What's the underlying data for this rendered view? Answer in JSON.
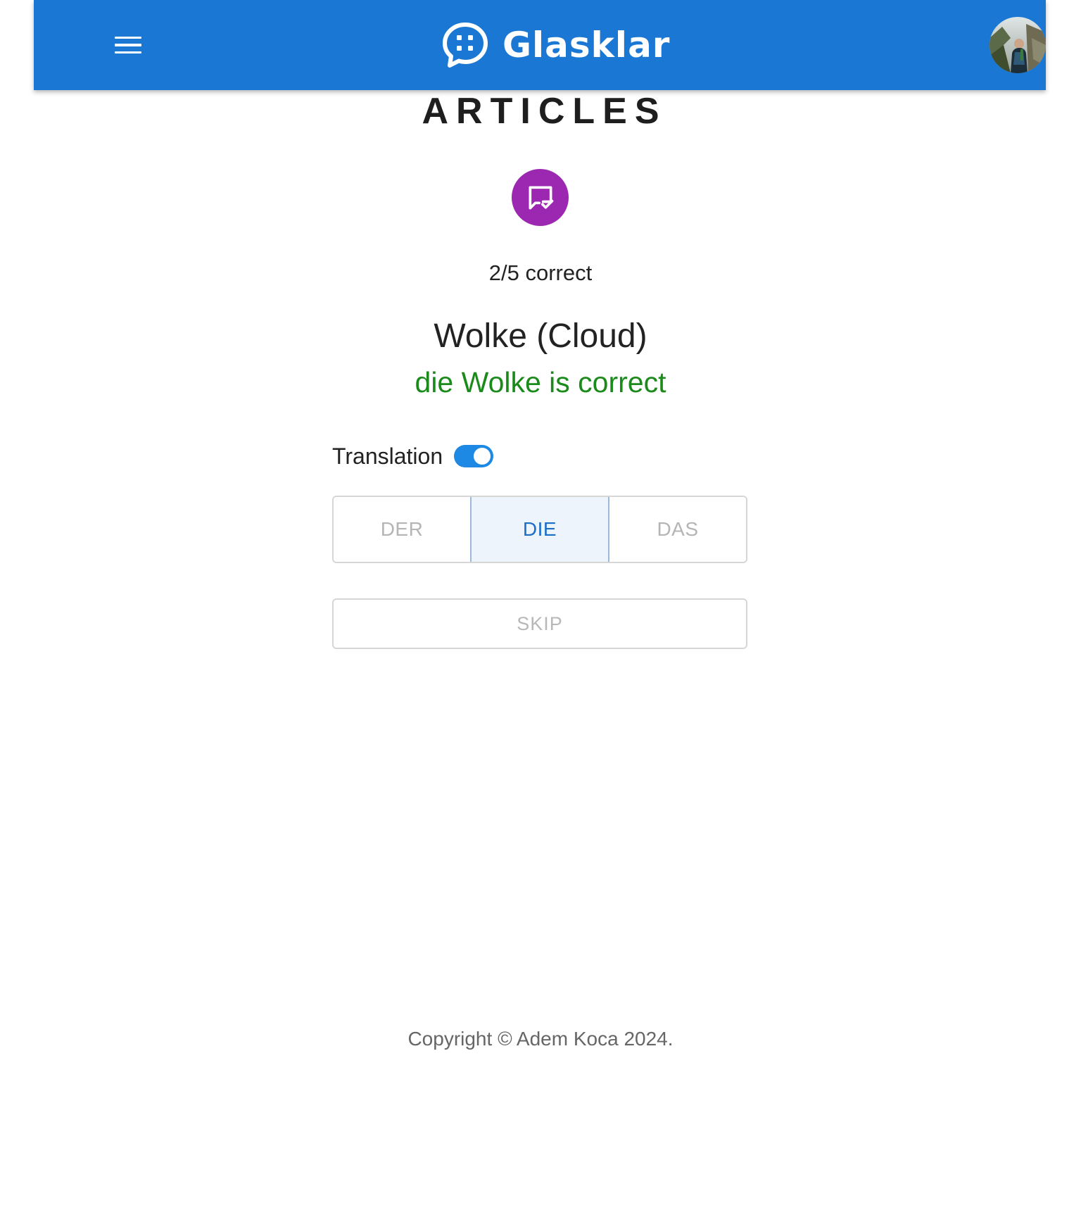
{
  "app": {
    "name": "Glasklar",
    "brand_color": "#1a78d4"
  },
  "header": {
    "menu_icon": "hamburger-menu-icon",
    "logo_icon": "chat-bubble-dots-icon",
    "avatar_icon": "user-avatar-photo"
  },
  "main": {
    "title": "ARTICLES",
    "badge_icon": "message-check-icon",
    "badge_color": "#9c27b0",
    "score": "2/5 correct",
    "word": "Wolke (Cloud)",
    "feedback": "die Wolke is correct",
    "feedback_color": "#1a8a1a",
    "translation_label": "Translation",
    "translation_enabled": true,
    "articles": [
      {
        "label": "DER",
        "selected": false
      },
      {
        "label": "DIE",
        "selected": true
      },
      {
        "label": "DAS",
        "selected": false
      }
    ],
    "skip_label": "SKIP"
  },
  "footer": {
    "copyright": "Copyright © Adem Koca 2024."
  }
}
